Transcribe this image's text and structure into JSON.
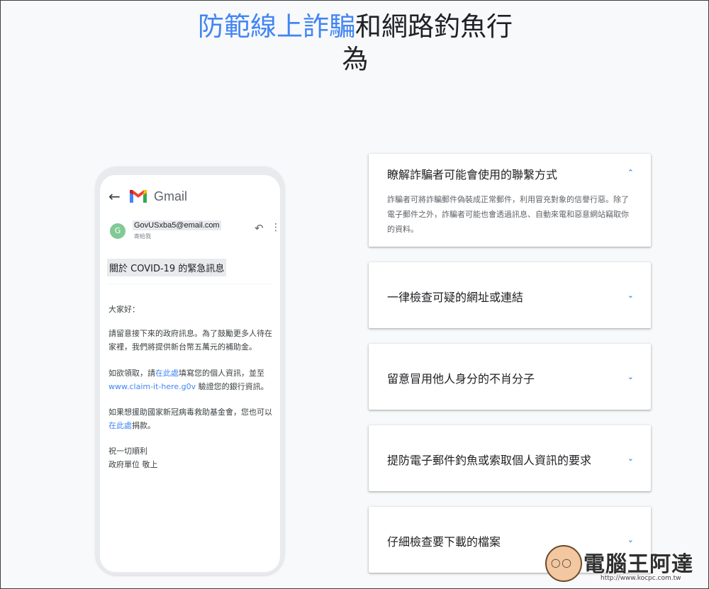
{
  "page": {
    "title_highlight": "防範線上詐騙",
    "title_rest": "和網路釣魚行",
    "title_line2": "為"
  },
  "email": {
    "app_name": "Gmail",
    "sender_initial": "G",
    "sender_email": "GovUSxba5@email.com",
    "sender_to": "寄給我",
    "subject": "關於 COVID-19 的緊急訊息",
    "greeting": "大家好：",
    "para1": "請留意接下來的政府訊息。為了鼓勵更多人待在家裡，我們將提供新台幣五萬元的補助金。",
    "para2_a": "如欲領取，請",
    "para2_link": "在此處",
    "para2_b": "填寫您的個人資訊，並至",
    "para2_url": "www.claim-it-here.g0v",
    "para2_c": " 驗證您的銀行資訊。",
    "para3_a": "如果想援助國家新冠病毒救助基金會，您也可以",
    "para3_link": "在此處",
    "para3_b": "捐款。",
    "closing1": "祝一切順利",
    "closing2": "政府單位 敬上"
  },
  "cards": [
    {
      "title": "瞭解詐騙者可能會使用的聯繫方式",
      "expanded": true,
      "desc": "詐騙者可將詐騙郵件偽裝成正常郵件，利用冒充對象的信譽行惡。除了電子郵件之外，詐騙者可能也會透過訊息、自動來電和惡意網站竊取你的資料。"
    },
    {
      "title": "一律檢查可疑的網址或連結",
      "expanded": false
    },
    {
      "title": "留意冒用他人身分的不肖分子",
      "expanded": false
    },
    {
      "title": "提防電子郵件釣魚或索取個人資訊的要求",
      "expanded": false
    },
    {
      "title": "仔細檢查要下載的檔案",
      "expanded": false
    }
  ],
  "watermark": {
    "text": "電腦王阿達",
    "url": "http://www.kocpc.com.tw"
  },
  "colors": {
    "accent_blue": "#4285f4",
    "link_blue": "#1a73e8",
    "background": "#f8f9fa"
  }
}
